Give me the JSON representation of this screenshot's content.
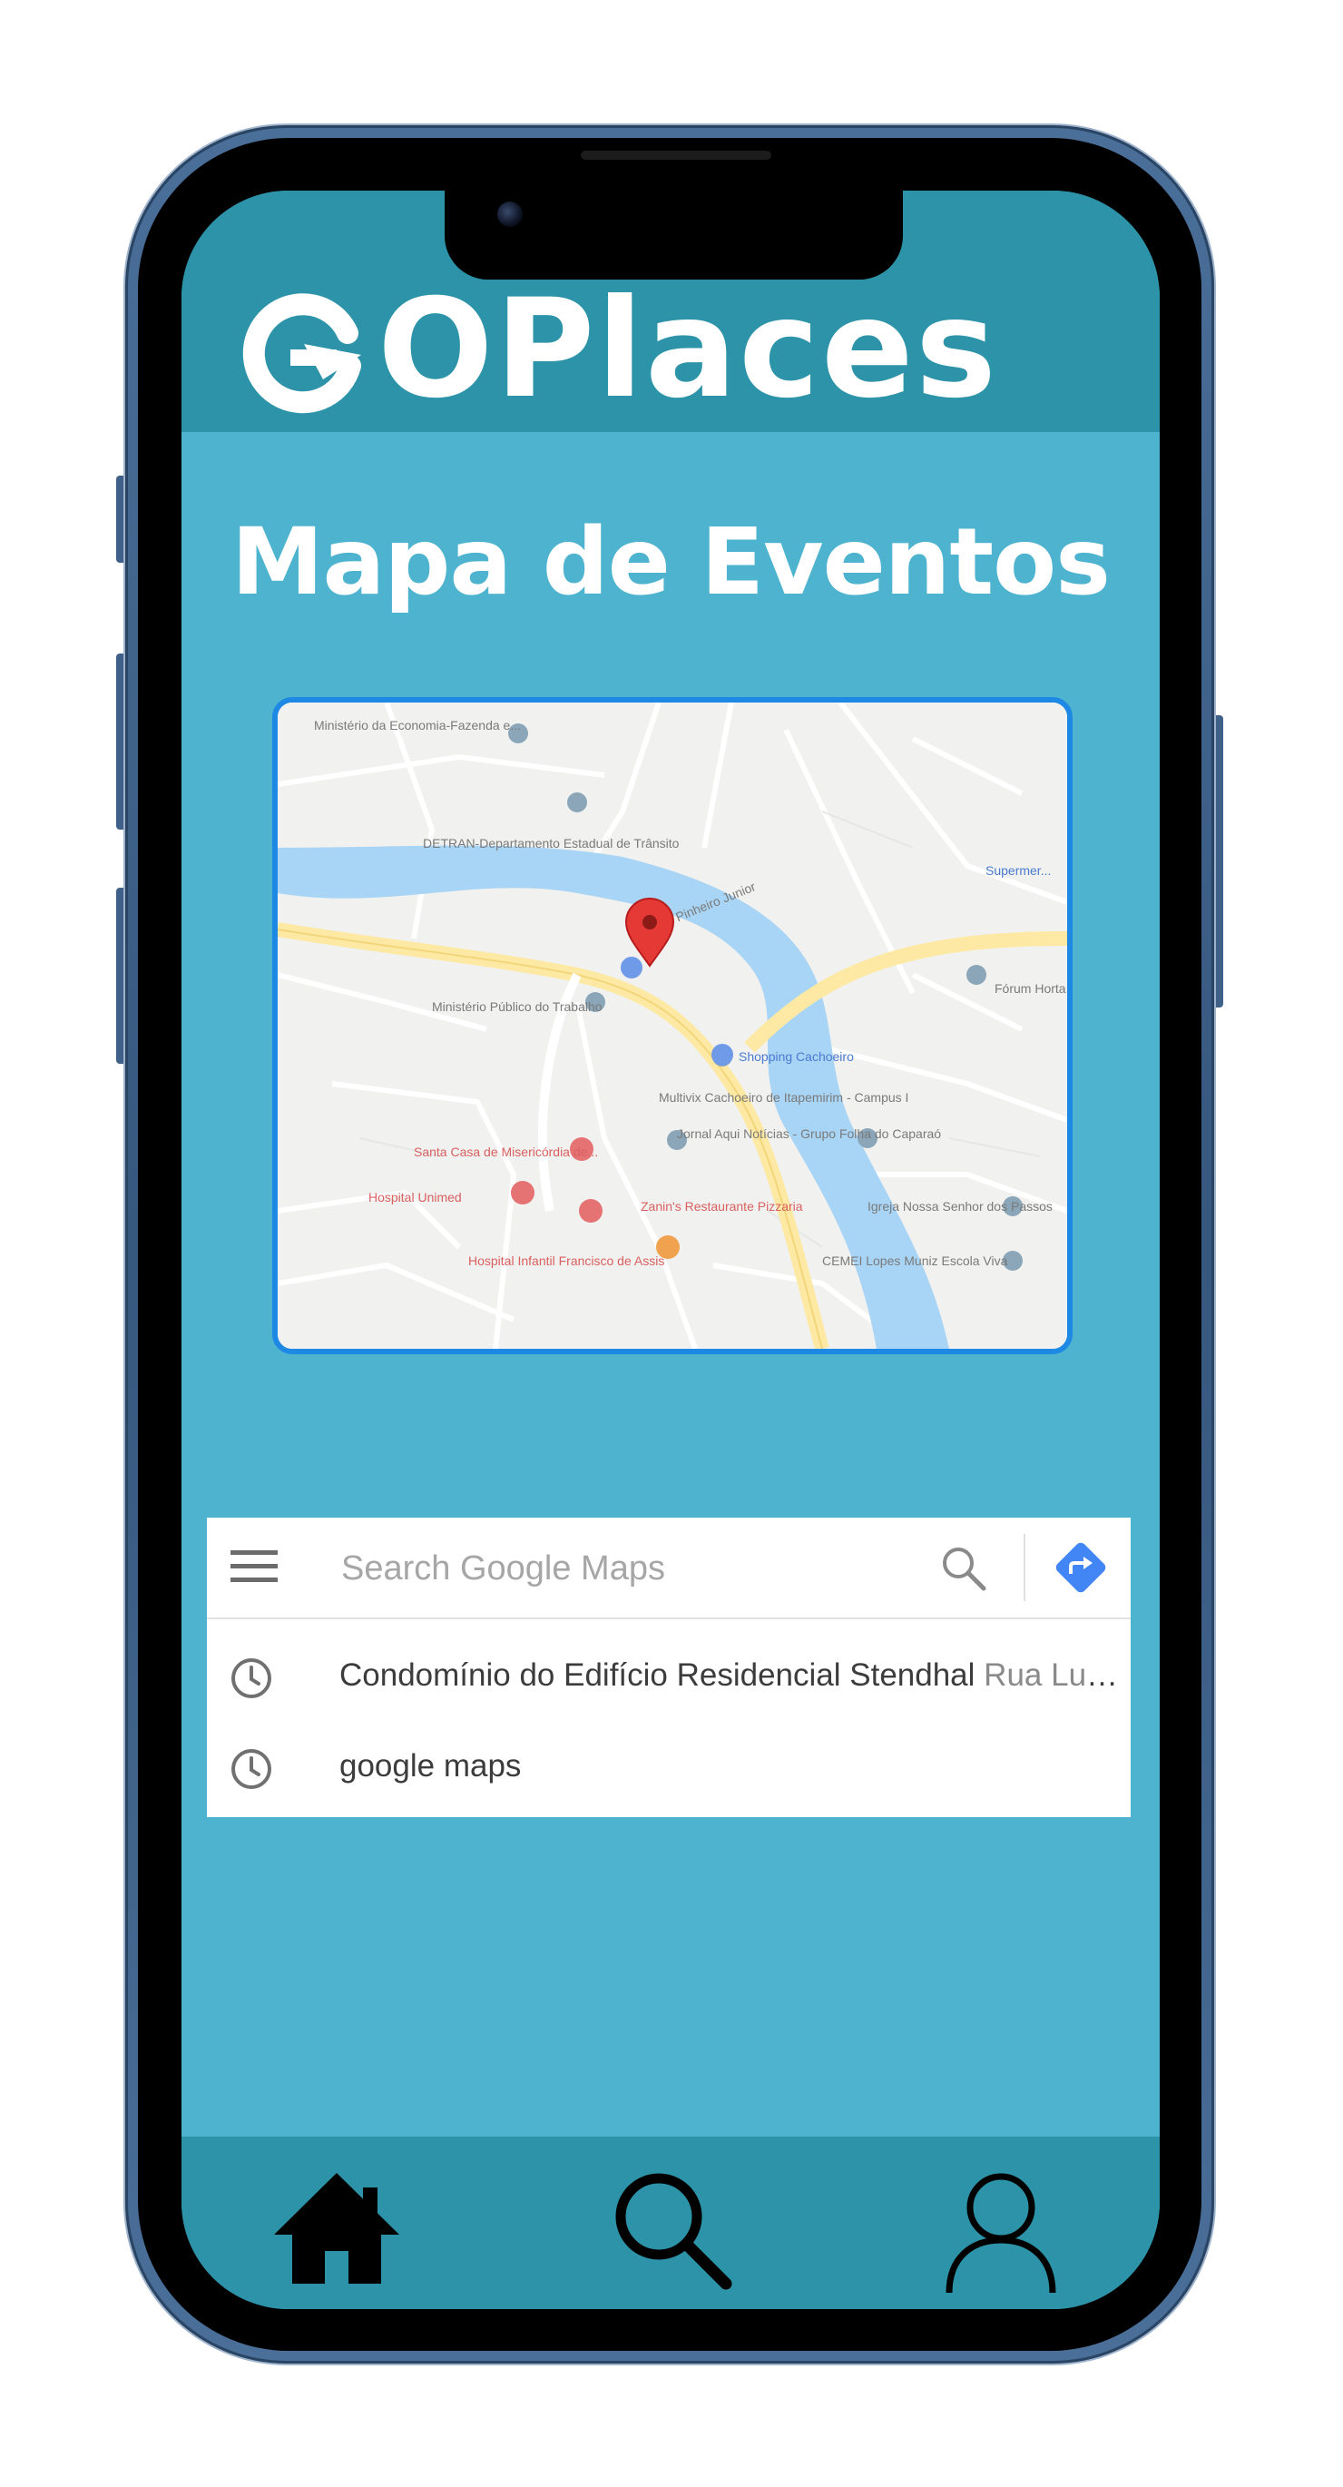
{
  "app": {
    "logo_text": "OPlaces",
    "logo_mark_icon": "circular-arrow-g-icon"
  },
  "page": {
    "title": "Mapa de Eventos"
  },
  "map": {
    "labels": [
      "Ministério da Economia-Fazenda e...",
      "DETRAN-Departamento Estadual de Trânsito",
      "Ministério Público do Trabalho",
      "Shopping Cachoeiro",
      "Multivix Cachoeiro de Itapemirim - Campus I",
      "Santa Casa de Misericórdia de...",
      "Hospital Unimed",
      "Zanin's Restaurante Pizzaria",
      "Hospital Infantil Francisco de Assis",
      "Igreja Nossa Senhor dos Passos",
      "Fórum Horta Dr...",
      "CEMEI Lopes Muniz Escola Viva",
      "Supermer...",
      "Jornal Aqui Notícias - Grupo Folha do Caparaó",
      "Av. Pinheiro Junior"
    ],
    "pin_color": "#e53935",
    "river_color": "#a8d4f5",
    "road_color": "#fde9a4"
  },
  "search": {
    "placeholder": "Search Google Maps",
    "menu_icon": "hamburger-menu-icon",
    "search_icon": "magnifier-icon",
    "directions_icon": "directions-diamond-icon",
    "recent": [
      {
        "main": "Condomínio do Edifício Residencial Stendhal",
        "sub": "Rua Luiz..."
      },
      {
        "main": "google maps",
        "sub": ""
      }
    ]
  },
  "nav": {
    "home_icon": "home-icon",
    "search_icon": "search-icon",
    "profile_icon": "user-icon"
  },
  "colors": {
    "header": "#2c93a9",
    "background": "#4db3cf",
    "map_border": "#1e88e5"
  }
}
